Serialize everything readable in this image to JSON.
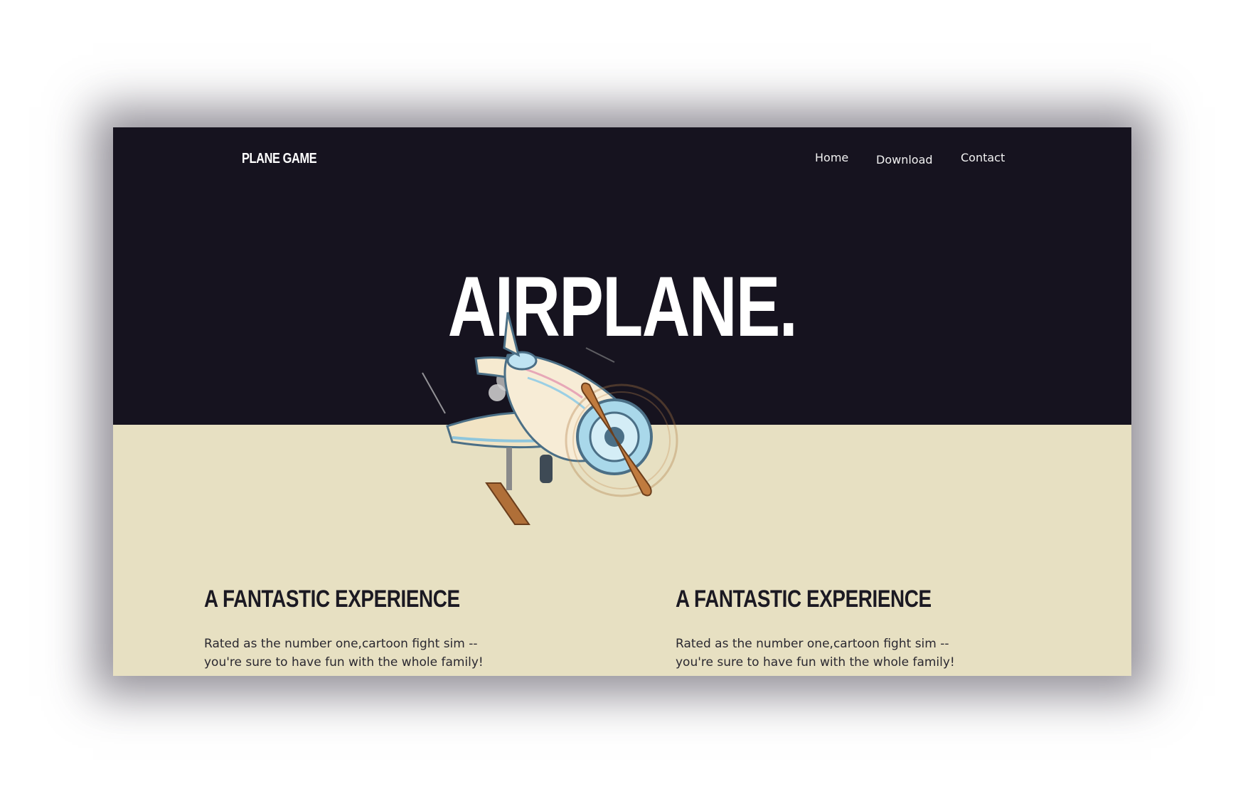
{
  "header": {
    "brand": "PLANE GAME",
    "nav": [
      {
        "label": "Home"
      },
      {
        "label": "Download"
      },
      {
        "label": "Contact"
      }
    ]
  },
  "hero": {
    "title": "AIRPLANE.",
    "image": "cartoon-airplane-illustration"
  },
  "features": [
    {
      "title": "A FANTASTIC EXPERIENCE",
      "text": "Rated as the number one,cartoon fight sim -- you're sure to have fun with the whole family!"
    },
    {
      "title": "A FANTASTIC EXPERIENCE",
      "text": "Rated as the number one,cartoon fight sim -- you're sure to have fun with the whole family!"
    }
  ],
  "colors": {
    "hero_bg": "#16131f",
    "body_bg": "#e7e0c2",
    "text_dark": "#1b1922",
    "text_light": "#ffffff"
  }
}
